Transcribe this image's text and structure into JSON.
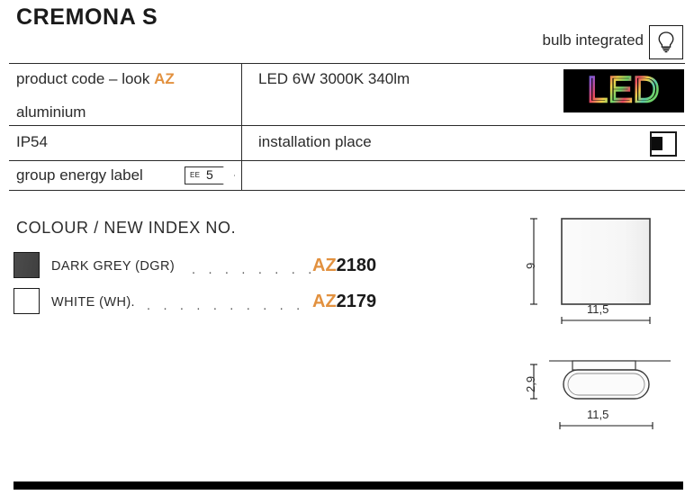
{
  "header": {
    "title": "CREMONA S",
    "bulb_label": "bulb integrated",
    "bulb_icon": "lightbulb-icon"
  },
  "spec_table": {
    "rows": [
      {
        "left_label": "product code – look ",
        "left_accent": "AZ",
        "right_label": "LED 6W 3000K 340lm",
        "right_badge": "led-logo"
      },
      {
        "left_label": "aluminium",
        "right_label": ""
      },
      {
        "left_label": "IP54",
        "right_label": "installation place",
        "right_badge": "wall-mount-icon"
      },
      {
        "left_label": "group energy label",
        "right_label": "",
        "left_badge": {
          "prefix": "EE",
          "value": "5"
        }
      }
    ],
    "led_logo_text": "LED"
  },
  "colour_section": {
    "heading": "COLOUR / NEW INDEX NO.",
    "items": [
      {
        "swatch_name": "dark-grey-swatch",
        "swatch_color": "#474747",
        "name": "DARK GREY (DGR)",
        "leader": ". . . . . . . .",
        "code_prefix": "AZ",
        "code_number": "2180"
      },
      {
        "swatch_name": "white-swatch",
        "swatch_color": "#ffffff",
        "name": "WHITE (WH).",
        "leader": ". . . . . . . . . .",
        "code_prefix": "AZ",
        "code_number": "2179"
      }
    ]
  },
  "drawings": {
    "front_view": {
      "name": "front-view-drawing",
      "height_label": "9",
      "width_label": "11,5"
    },
    "side_view": {
      "name": "side-view-drawing",
      "height_label": "2,9",
      "width_label": "11,5"
    }
  },
  "colors": {
    "accent_orange": "#E2913F",
    "text_dark": "#2b2b2b",
    "rule": "#2b2b2b"
  }
}
